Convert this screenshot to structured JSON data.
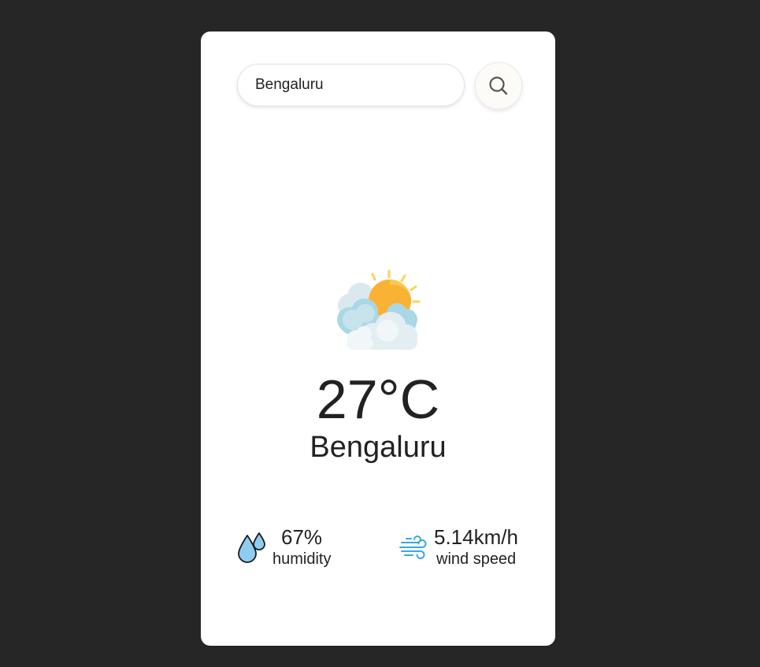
{
  "search": {
    "value": "Bengaluru",
    "button_icon": "search-icon"
  },
  "weather": {
    "icon": "partly-cloudy-icon",
    "temperature": "27°C",
    "city": "Bengaluru"
  },
  "humidity": {
    "icon": "humidity-icon",
    "value": "67%",
    "label": "humidity"
  },
  "wind": {
    "icon": "wind-icon",
    "value": "5.14km/h",
    "label": "wind speed"
  },
  "colors": {
    "background": "#262626",
    "card": "#ffffff",
    "text": "#222222",
    "drop": "#8ecdf2",
    "wind": "#3aa8e0",
    "sun": "#f9b233"
  }
}
